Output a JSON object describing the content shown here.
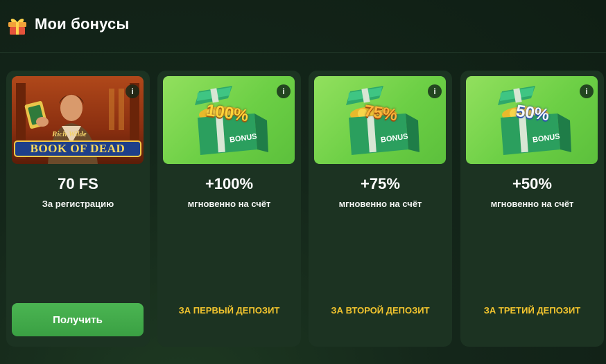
{
  "header": {
    "title": "Мои бонусы",
    "icon": "gift-icon"
  },
  "cards": [
    {
      "image_icon": "book-of-dead-slot-image",
      "image_text": {
        "line1": "Rich Wilde",
        "line2": "BOOK OF DEAD"
      },
      "amount": "70 FS",
      "description": "За регистрацию",
      "button_label": "Получить"
    },
    {
      "image_icon": "bonus-chest-icon",
      "image_text": {
        "percent": "100%",
        "bonus": "BONUS"
      },
      "amount": "+100%",
      "description": "мгновенно на счёт",
      "condition": "ЗА ПЕРВЫЙ ДЕПОЗИТ"
    },
    {
      "image_icon": "bonus-chest-icon",
      "image_text": {
        "percent": "75%",
        "bonus": "BONUS"
      },
      "amount": "+75%",
      "description": "мгновенно на счёт",
      "condition": "ЗА ВТОРОЙ ДЕПОЗИТ"
    },
    {
      "image_icon": "bonus-chest-icon",
      "image_text": {
        "percent": "50%",
        "bonus": "BONUS"
      },
      "amount": "+50%",
      "description": "мгновенно на счёт",
      "condition": "ЗА ТРЕТИЙ ДЕПОЗИТ"
    }
  ],
  "info_label": "i",
  "colors": {
    "background": "#14261a",
    "card": "#1c3322",
    "accent_green": "#3aa043",
    "condition_yellow": "#f2c42e",
    "image_green": "#6ccf45"
  }
}
